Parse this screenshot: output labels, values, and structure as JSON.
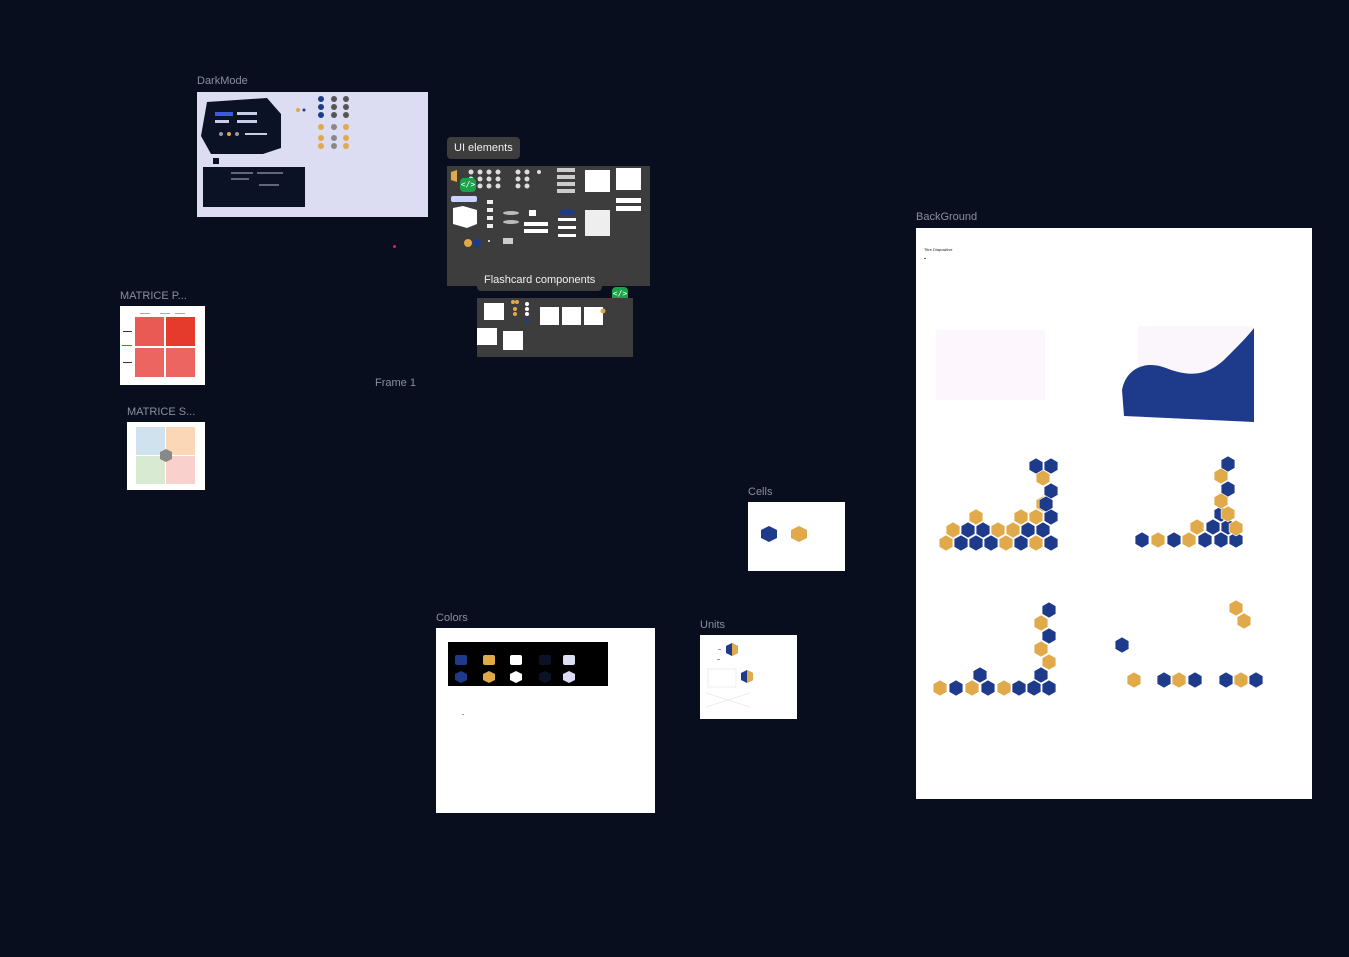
{
  "frames": {
    "darkmode": {
      "label": "DarkMode"
    },
    "ui_elements": {
      "label": "UI elements"
    },
    "flashcard": {
      "label": "Flashcard components"
    },
    "matrice_p": {
      "label": "MATRICE P..."
    },
    "matrice_s": {
      "label": "MATRICE S..."
    },
    "frame1": {
      "label": "Frame 1"
    },
    "cells": {
      "label": "Cells"
    },
    "colors": {
      "label": "Colors"
    },
    "units": {
      "label": "Units"
    },
    "background": {
      "label": "BackGround",
      "inner_title": "Titre Diapositive"
    }
  },
  "code_badge_glyph": "</>",
  "colors": {
    "canvas": "#080e1e",
    "navy": "#1e3a8a",
    "gold": "#e0a94a",
    "white": "#ffffff",
    "dark": "#0b1226",
    "lavender": "#dcdcf2",
    "red": "#ea5a54",
    "bright_red": "#e43b2c"
  },
  "icons": [
    "code-icon",
    "hexagon-icon"
  ]
}
